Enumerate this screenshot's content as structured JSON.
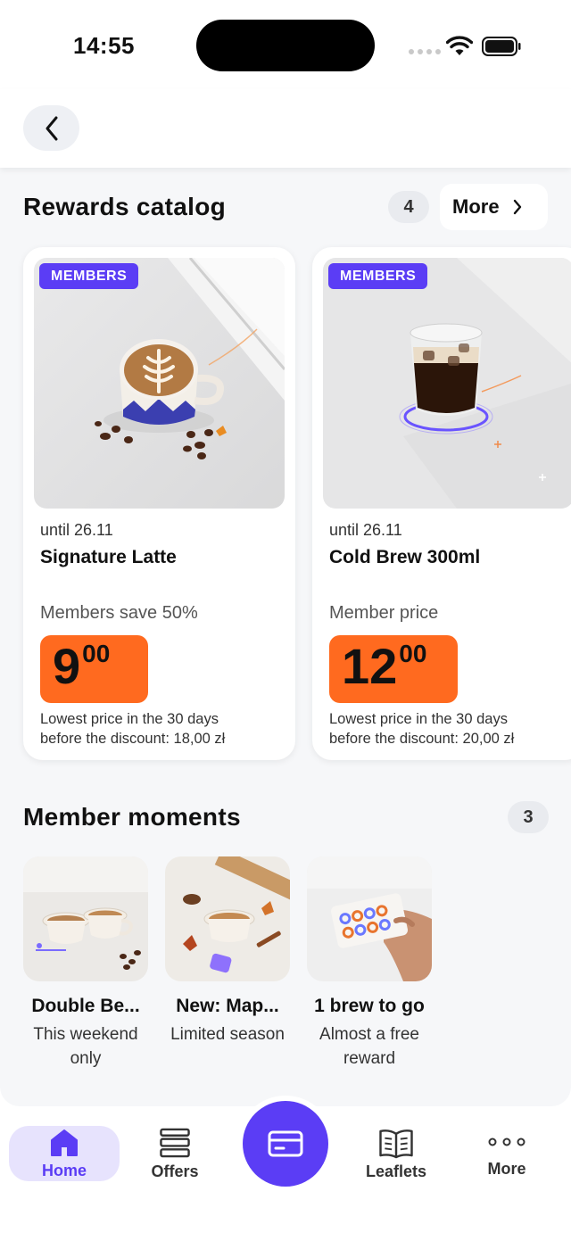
{
  "status": {
    "time": "14:55"
  },
  "rewards": {
    "title": "Rewards catalog",
    "count": "4",
    "more_label": "More",
    "items": [
      {
        "badge": "MEMBERS",
        "until": "until 26.11",
        "name": "Signature Latte",
        "promo": "Members save 50%",
        "price_int": "9",
        "price_dec": "00",
        "lowest_line1": "Lowest price in the 30 days",
        "lowest_line2": "before the discount: 18,00 zł"
      },
      {
        "badge": "MEMBERS",
        "until": "until 26.11",
        "name": "Cold Brew 300ml",
        "promo": "Member price",
        "price_int": "12",
        "price_dec": "00",
        "lowest_line1": "Lowest price in the 30 days",
        "lowest_line2": "before the discount: 20,00 zł"
      }
    ]
  },
  "moments": {
    "title": "Member moments",
    "count": "3",
    "items": [
      {
        "title": "Double Be...",
        "subtitle": "This weekend only"
      },
      {
        "title": "New: Map...",
        "subtitle": "Limited season"
      },
      {
        "title": "1 brew to go",
        "subtitle": "Almost a free reward"
      }
    ]
  },
  "tabbar": {
    "home": "Home",
    "offers": "Offers",
    "leaflets": "Leaflets",
    "more": "More"
  },
  "colors": {
    "accent": "#5b3df5",
    "price": "#ff6a1f",
    "background": "#f6f7f9"
  }
}
